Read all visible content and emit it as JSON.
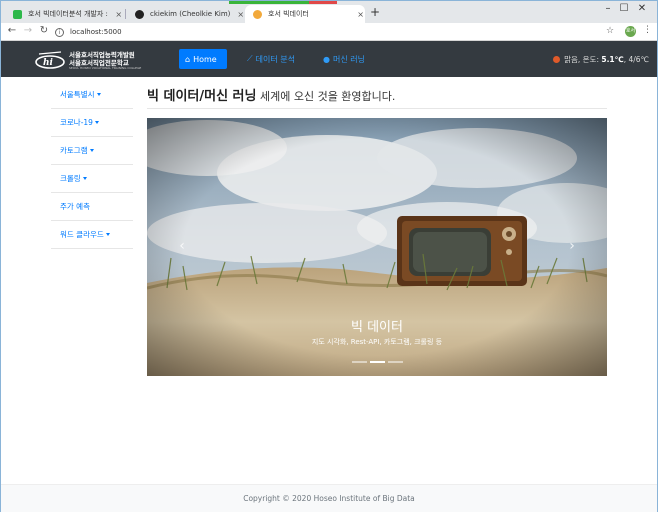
{
  "browser": {
    "tabs": [
      {
        "title": "호서 빅데이터분석 개발자 : 메...",
        "fav_color": "#2db84a"
      },
      {
        "title": "ckiekim (Cheolkie Kim)",
        "fav_color": "#222222"
      },
      {
        "title": "호서 빅데이터",
        "fav_color": "#f2a93b"
      }
    ],
    "new_tab_glyph": "+",
    "close_glyph": "×",
    "address": "localhost:5000",
    "profile_initials": "호서",
    "window_controls": [
      "–",
      "☐",
      "✕"
    ]
  },
  "navbar": {
    "logo": {
      "line1": "서울호서직업능력개발원",
      "line2": "서울호서직업전문학교",
      "line3": "SEOUL HOSEO VOCATIONAL TRAINING COLLEGE"
    },
    "links": [
      {
        "label": "Home",
        "icon": "home-icon",
        "glyph": "⌂",
        "active": true
      },
      {
        "label": "데이터 분석",
        "icon": "chart-line-icon",
        "glyph": "⟋",
        "active": false
      },
      {
        "label": "머신 러닝",
        "icon": "brain-icon",
        "glyph": "●",
        "active": false
      }
    ],
    "weather": {
      "condition": "맑음,",
      "label": "온도:",
      "temp": "5.1℃",
      "range": ", 4/6℃"
    }
  },
  "sidebar": {
    "items": [
      {
        "label": "서울특별시",
        "dropdown": true
      },
      {
        "label": "코로나-19",
        "dropdown": true
      },
      {
        "label": "카토그램",
        "dropdown": true
      },
      {
        "label": "크롤링",
        "dropdown": true
      },
      {
        "label": "주가 예측",
        "dropdown": false
      },
      {
        "label": "워드 클라우드",
        "dropdown": true
      }
    ]
  },
  "main": {
    "heading_bold": "빅 데이터/머신 러닝",
    "heading_light": " 세계에 오신 것을 환영합니다."
  },
  "carousel": {
    "caption_title": "빅 데이터",
    "caption_text": "지도 시각화, Rest-API, 카토그램, 크롤링 등",
    "prev_glyph": "‹",
    "next_glyph": "›",
    "slides": 3,
    "active_slide": 2
  },
  "footer": {
    "text": "Copyright © 2020 Hoseo Institute of Big Data"
  }
}
